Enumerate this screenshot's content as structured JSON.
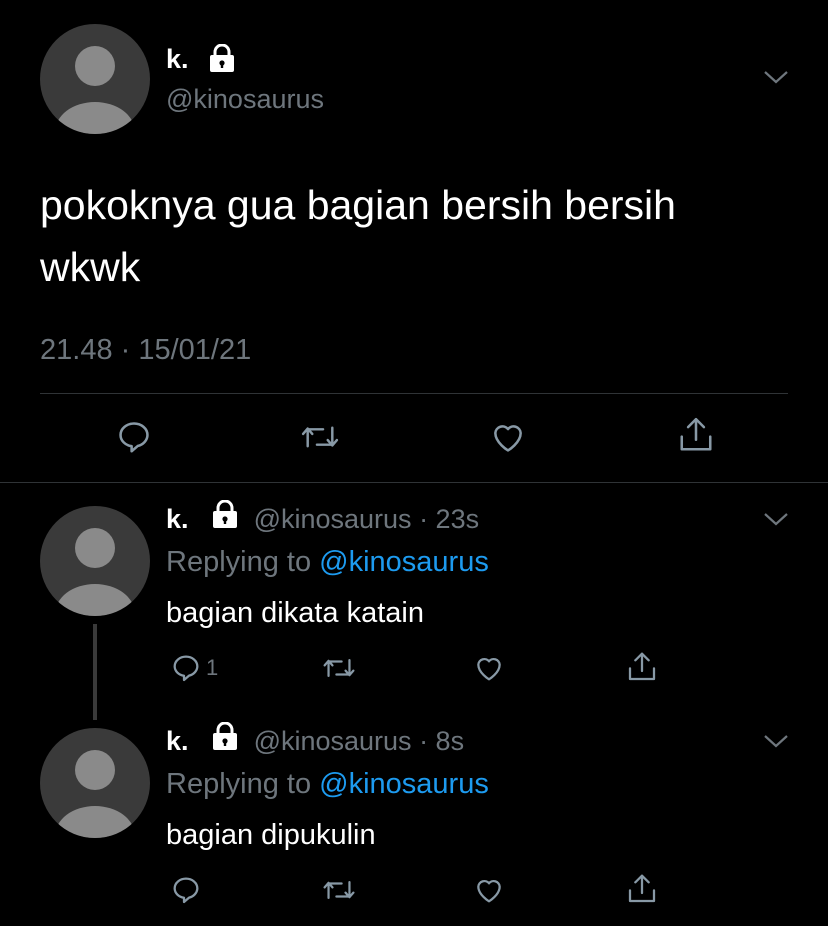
{
  "colors": {
    "background": "#000000",
    "text": "#ffffff",
    "secondary": "#6e767d",
    "link": "#1d9bf0",
    "divider": "#2f3336"
  },
  "main_tweet": {
    "name": "k.",
    "handle": "@kinosaurus",
    "text_line1": "pokoknya gua bagian bersih bersih",
    "text_line2": "wkwk",
    "timestamp": "21.48 · 15/01/21",
    "icons": [
      "reply-icon",
      "retweet-icon",
      "like-icon",
      "share-icon"
    ]
  },
  "replies": [
    {
      "name": "k.",
      "handle": "@kinosaurus",
      "time": "· 23s",
      "replying_prefix": "Replying to",
      "replying_to": "@kinosaurus",
      "text": "bagian dikata katain",
      "reply_count": "1"
    },
    {
      "name": "k.",
      "handle": "@kinosaurus",
      "time": "· 8s",
      "replying_prefix": "Replying to",
      "replying_to": "@kinosaurus",
      "text": "bagian dipukulin",
      "reply_count": ""
    }
  ]
}
